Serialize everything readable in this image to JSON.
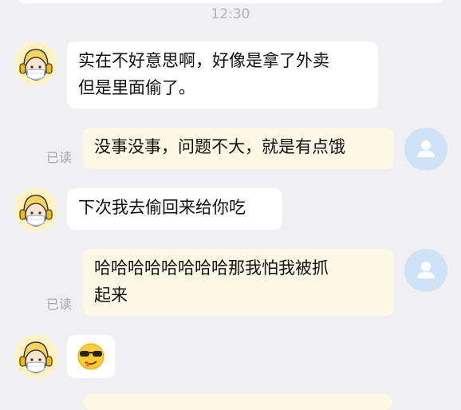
{
  "chat": {
    "timestamp": "12:30",
    "read_status": "已读",
    "messages": [
      {
        "sender": "other",
        "lines": [
          "实在不好意思啊，好像是拿了外卖",
          "但是里面偷了。"
        ]
      },
      {
        "sender": "me",
        "lines": [
          "没事没事，问题不大，就是有点饿"
        ]
      },
      {
        "sender": "other",
        "lines": [
          "下次我去偷回来给你吃"
        ]
      },
      {
        "sender": "me",
        "lines": [
          "哈哈哈哈哈哈哈哈那我怕我被抓",
          "起来"
        ]
      },
      {
        "sender": "other",
        "sticker": "cool-sunglasses-emoji"
      }
    ]
  },
  "colors": {
    "background": "#f0f0f2",
    "incoming_bubble": "#ffffff",
    "outgoing_bubble": "#fdf8e6",
    "user_avatar": "#cfe3f7",
    "read_label": "#a8a8ac"
  },
  "icons": {
    "other_avatar": "masked-character-with-headphones-avatar",
    "user_avatar": "default-user-silhouette-avatar"
  }
}
